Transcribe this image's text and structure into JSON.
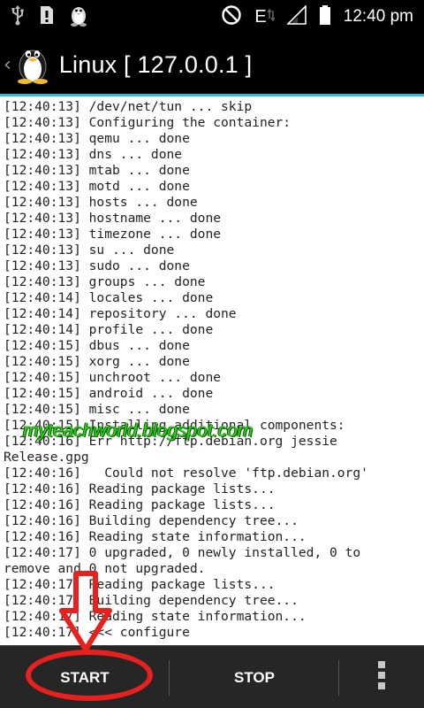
{
  "status_bar": {
    "icons": [
      "usb-icon",
      "sd-card-icon",
      "linux-penguin-icon",
      "do-not-disturb-icon",
      "network-e-icon",
      "signal-icon",
      "battery-icon"
    ],
    "network_label": "E",
    "time": "12:40 pm"
  },
  "action_bar": {
    "up_caret": "‹",
    "title": "Linux  [ 127.0.0.1 ]"
  },
  "terminal": {
    "lines": [
      "[12:40:13] /dev/net/tun ... skip",
      "[12:40:13] Configuring the container:",
      "[12:40:13] qemu ... done",
      "[12:40:13] dns ... done",
      "[12:40:13] mtab ... done",
      "[12:40:13] motd ... done",
      "[12:40:13] hosts ... done",
      "[12:40:13] hostname ... done",
      "[12:40:13] timezone ... done",
      "[12:40:13] su ... done",
      "[12:40:13] sudo ... done",
      "[12:40:13] groups ... done",
      "[12:40:14] locales ... done",
      "[12:40:14] repository ... done",
      "[12:40:14] profile ... done",
      "[12:40:15] dbus ... done",
      "[12:40:15] xorg ... done",
      "[12:40:15] unchroot ... done",
      "[12:40:15] android ... done",
      "[12:40:15] misc ... done",
      "[12:40:15] Installing additional components:",
      "[12:40:16] Err http://ftp.debian.org jessie",
      "Release.gpg",
      "[12:40:16]   Could not resolve 'ftp.debian.org'",
      "[12:40:16] Reading package lists...",
      "[12:40:16] Reading package lists...",
      "[12:40:16] Building dependency tree...",
      "[12:40:16] Reading state information...",
      "[12:40:17] 0 upgraded, 0 newly installed, 0 to",
      "remove and 0 not upgraded.",
      "[12:40:17] Reading package lists...",
      "[12:40:17] Building dependency tree...",
      "[12:40:17] Reading state information...",
      "[12:40:17] <<< configure"
    ],
    "watermark": "myteachworld.blogspot.com"
  },
  "bottom_bar": {
    "start_label": "START",
    "stop_label": "STOP"
  },
  "colors": {
    "accent": "#33b5e5",
    "annotation": "#e8201e",
    "watermark": "#2bd416"
  }
}
